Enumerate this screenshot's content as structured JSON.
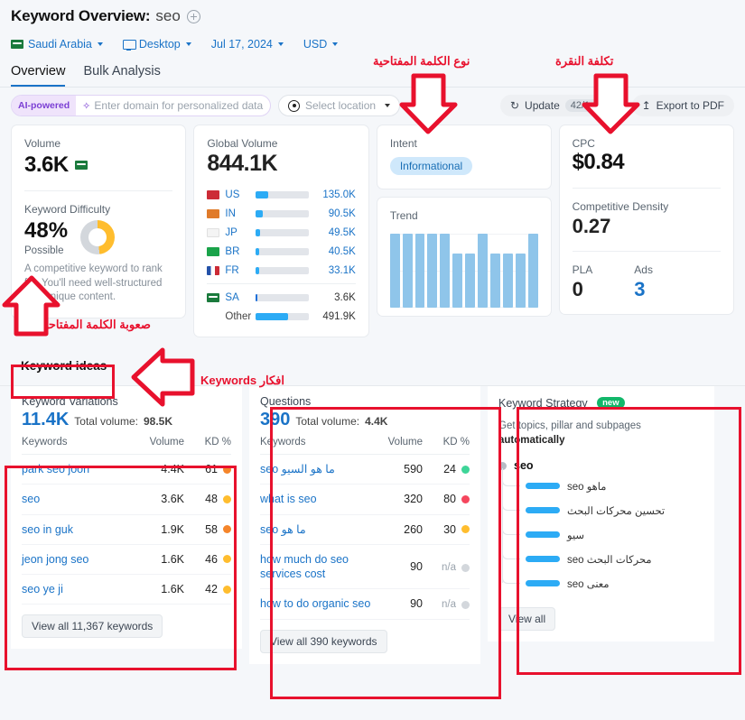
{
  "header": {
    "title_prefix": "Keyword Overview:",
    "keyword": "seo",
    "add_icon": "plus-circle-icon",
    "filters": [
      {
        "label": "Saudi Arabia",
        "icon": "flag-sa-icon"
      },
      {
        "label": "Desktop",
        "icon": "monitor-icon"
      },
      {
        "label": "Jul 17, 2024",
        "icon": ""
      },
      {
        "label": "USD",
        "icon": ""
      }
    ]
  },
  "tabs": [
    {
      "label": "Overview",
      "active": true
    },
    {
      "label": "Bulk Analysis",
      "active": false
    }
  ],
  "toolbar": {
    "ai_badge": "AI-powered",
    "domain_placeholder": "Enter domain for personalized data",
    "location_placeholder": "Select location",
    "update_label": "Update",
    "update_counter": "42/1,000",
    "export_label": "Export to PDF"
  },
  "cards": {
    "volume": {
      "label": "Volume",
      "value": "3.6K",
      "flag": "flag-sa-icon",
      "kd_label": "Keyword Difficulty",
      "kd_value": "48%",
      "kd_percent": 48,
      "kd_status": "Possible",
      "kd_desc": "A competitive keyword to rank for. You'll need well-structured and unique content."
    },
    "global": {
      "label": "Global Volume",
      "value": "844.1K",
      "rows": [
        {
          "code": "US",
          "volume": "135.0K",
          "pct": 24,
          "flag": "#cc2b36"
        },
        {
          "code": "IN",
          "volume": "90.5K",
          "pct": 13,
          "flag": "#e07b2a"
        },
        {
          "code": "JP",
          "volume": "49.5K",
          "pct": 8,
          "flag": "#f0f0f0"
        },
        {
          "code": "BR",
          "volume": "40.5K",
          "pct": 7,
          "flag": "#1aa34a"
        },
        {
          "code": "FR",
          "volume": "33.1K",
          "pct": 6,
          "flag": "#2452a8"
        }
      ],
      "footer_rows": [
        {
          "code": "SA",
          "volume": "3.6K",
          "pct": 3,
          "flag": "#1a7a3c"
        },
        {
          "code": "Other",
          "volume": "491.9K",
          "pct": 61,
          "flag": ""
        }
      ]
    },
    "intent": {
      "label": "Intent",
      "value": "Informational"
    },
    "trend": {
      "label": "Trend",
      "bars": [
        100,
        100,
        100,
        100,
        100,
        73,
        73,
        100,
        73,
        73,
        73,
        100
      ]
    },
    "cpc": {
      "label": "CPC",
      "value": "$0.84",
      "density_label": "Competitive Density",
      "density_value": "0.27",
      "pla_label": "PLA",
      "pla_value": "0",
      "ads_label": "Ads",
      "ads_value": "3"
    }
  },
  "ideas": {
    "tab_label": "Keyword ideas",
    "variations": {
      "title": "Keyword Variations",
      "count": "11.4K",
      "total": "Total volume:",
      "total_value": "98.5K",
      "columns": [
        "Keywords",
        "Volume",
        "KD %"
      ],
      "rows": [
        {
          "keyword": "park seo joon",
          "volume": "4.4K",
          "kd": "61",
          "color": "#f5852a"
        },
        {
          "keyword": "seo",
          "volume": "3.6K",
          "kd": "48",
          "color": "#ffbd2e"
        },
        {
          "keyword": "seo in guk",
          "volume": "1.9K",
          "kd": "58",
          "color": "#f5852a"
        },
        {
          "keyword": "jeon jong seo",
          "volume": "1.6K",
          "kd": "46",
          "color": "#ffbd2e"
        },
        {
          "keyword": "seo ye ji",
          "volume": "1.6K",
          "kd": "42",
          "color": "#ffbd2e"
        }
      ],
      "view_all": "View all 11,367 keywords"
    },
    "questions": {
      "title": "Questions",
      "count": "390",
      "total": "Total volume:",
      "total_value": "4.4K",
      "columns": [
        "Keywords",
        "Volume",
        "KD %"
      ],
      "rows": [
        {
          "keyword": "ما هو السيو seo",
          "volume": "590",
          "kd": "24",
          "color": "#3ed598"
        },
        {
          "keyword": "what is seo",
          "volume": "320",
          "kd": "80",
          "color": "#f5465d"
        },
        {
          "keyword": "ما هو seo",
          "volume": "260",
          "kd": "30",
          "color": "#ffbd2e"
        },
        {
          "keyword": "how much do seo services cost",
          "volume": "90",
          "kd": "n/a",
          "color": "#d3d7dc"
        },
        {
          "keyword": "how to do organic seo",
          "volume": "90",
          "kd": "n/a",
          "color": "#d3d7dc"
        }
      ],
      "view_all": "View all 390 keywords"
    },
    "strategy": {
      "title": "Keyword Strategy",
      "badge": "new",
      "subtitle_plain": "Get topics, pillar and subpages ",
      "subtitle_bold": "automatically",
      "root": "seo",
      "items": [
        {
          "label": "ماهو seo"
        },
        {
          "label": "تحسين محركات البحث"
        },
        {
          "label": "سيو"
        },
        {
          "label": "محركات البحث seo"
        },
        {
          "label": "معنى seo"
        }
      ],
      "view_all": "View all"
    }
  },
  "annotations": {
    "color": "#e8112d",
    "intent_label": "نوع الكلمة المفتاحية",
    "cpc_label": "تكلفة النقرة",
    "kd_label": "صعوبة الكلمة المفتاحية",
    "ideas_label": "افكار Keywords"
  }
}
